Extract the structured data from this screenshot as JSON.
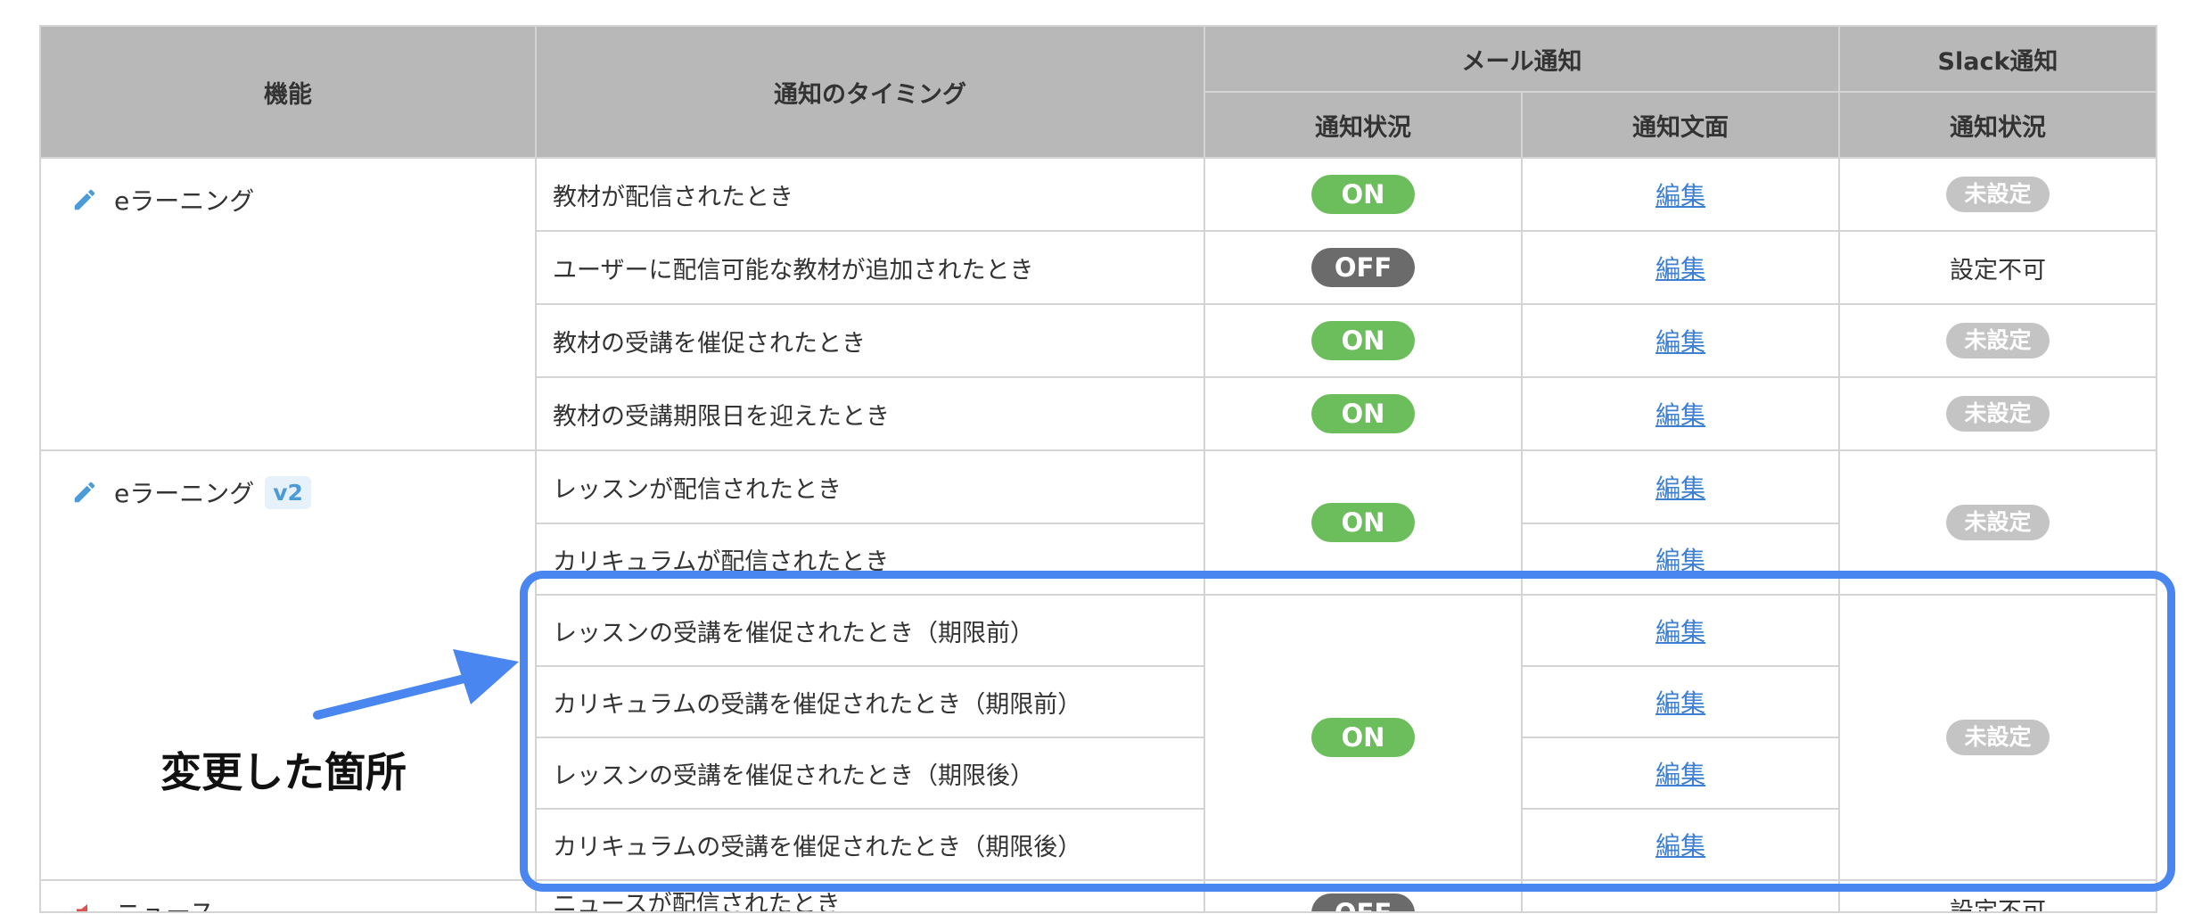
{
  "header": {
    "feature": "機能",
    "timing": "通知のタイミング",
    "mail": "メール通知",
    "slack": "Slack通知",
    "mail_status": "通知状況",
    "mail_text": "通知文面",
    "slack_status": "通知状況"
  },
  "groups": [
    {
      "feature": "eラーニング",
      "icon": "pencil-icon",
      "rows": [
        {
          "timing": "教材が配信されたとき",
          "mail_status": "ON",
          "edit": "編集",
          "slack": "未設定"
        },
        {
          "timing": "ユーザーに配信可能な教材が追加されたとき",
          "mail_status": "OFF",
          "edit": "編集",
          "slack": "設定不可"
        },
        {
          "timing": "教材の受講を催促されたとき",
          "mail_status": "ON",
          "edit": "編集",
          "slack": "未設定"
        },
        {
          "timing": "教材の受講期限日を迎えたとき",
          "mail_status": "ON",
          "edit": "編集",
          "slack": "未設定"
        }
      ]
    },
    {
      "feature": "eラーニング",
      "badge": "v2",
      "icon": "pencil-icon",
      "blocks": [
        {
          "mail_status": "ON",
          "slack": "未設定",
          "rows": [
            {
              "timing": "レッスンが配信されたとき",
              "edit": "編集"
            },
            {
              "timing": "カリキュラムが配信されたとき",
              "edit": "編集"
            }
          ]
        },
        {
          "mail_status": "ON",
          "slack": "未設定",
          "rows": [
            {
              "timing": "レッスンの受講を催促されたとき（期限前）",
              "edit": "編集"
            },
            {
              "timing": "カリキュラムの受講を催促されたとき（期限前）",
              "edit": "編集"
            },
            {
              "timing": "レッスンの受講を催促されたとき（期限後）",
              "edit": "編集"
            },
            {
              "timing": "カリキュラムの受講を催促されたとき（期限後）",
              "edit": "編集"
            }
          ]
        }
      ]
    },
    {
      "feature": "ニュース",
      "icon": "megaphone-icon",
      "rows": [
        {
          "timing": "ニュースが配信されたとき",
          "mail_status": "OFF",
          "slack": "設定不可"
        }
      ]
    }
  ],
  "annotation": {
    "label": "変更した箇所",
    "color": "#4a86f0"
  },
  "colors": {
    "header_bg": "#b8b8b8",
    "on": "#6cbd5c",
    "off": "#6b6b6b",
    "unset": "#c4c4c4",
    "link": "#3d7fd0"
  }
}
